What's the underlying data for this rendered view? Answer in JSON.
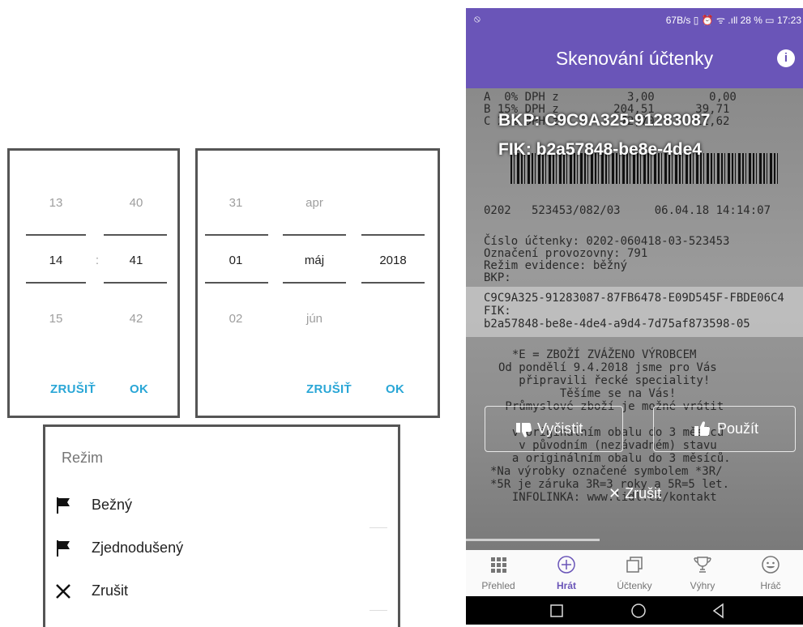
{
  "time_picker": {
    "hours": [
      "13",
      "14",
      "15"
    ],
    "minutes": [
      "40",
      "41",
      "42"
    ],
    "separator": ":",
    "cancel_label": "ZRUŠIŤ",
    "ok_label": "OK"
  },
  "date_picker": {
    "days": [
      "31",
      "01",
      "02"
    ],
    "months": [
      "apr",
      "máj",
      "jún"
    ],
    "year": "2018",
    "cancel_label": "ZRUŠIŤ",
    "ok_label": "OK"
  },
  "mode_dialog": {
    "title": "Režim",
    "options": [
      {
        "label": "Bežný",
        "icon": "flag-icon"
      },
      {
        "label": "Zjednodušený",
        "icon": "flag-icon"
      },
      {
        "label": "Zrušit",
        "icon": "close-icon"
      }
    ]
  },
  "phone": {
    "status": {
      "left_icon": "location-off-icon",
      "right": "67B/s ▯ ⏰ ᯤ .ıll 28 % ▭ 17:23"
    },
    "title": "Skenování účtenky",
    "info_icon": "info-icon",
    "overlay": {
      "bkp": "BKP: C9C9A325-91283087",
      "fik": "FIK: b2a57848-be8e-4de4"
    },
    "receipt_lines": [
      "A  0% DPH z          3,00        0,00",
      "B 15% DPH z        204,51      39,71",
      "C 21% DPH z         72,70      12,62",
      "0202   523453/082/03     06.04.18 14:14:07",
      "Číslo účtenky: 0202-060418-03-523453",
      "Označení provozovny: 791",
      "Režim evidence: běžný",
      "BKP:",
      "C9C9A325-91283087-87FB6478-E09D545F-FBDE06C4",
      "FIK:",
      "b2a57848-be8e-4de4-a9d4-7d75af873598-05",
      "  *E = ZBOŽÍ ZVÁŽENO VÝROBCEM",
      "Od pondělí 9.4.2018 jsme pro Vás",
      "   připravili řecké speciality!",
      "         Těšíme se na Vás!",
      " Průmyslové zboží je možné vrátit",
      "  v originálním obalu do 3 měsíců",
      "   v původním (nezávadném) stavu",
      "  a originálním obalu do 3 měsíců.",
      "*Na výrobky označené symbolem *3R/",
      "*5R je záruka 3R=3 roky a 5R=5 let.",
      "  INFOLINKA: www.lidl.cz/kontakt"
    ],
    "actions": {
      "clear_label": "Vyčistit",
      "use_label": "Použít",
      "cancel_label": "✕ Zrušit"
    },
    "nav": [
      {
        "label": "Přehled",
        "icon": "grid-icon",
        "active": false
      },
      {
        "label": "Hrát",
        "icon": "plus-circle-icon",
        "active": true
      },
      {
        "label": "Účtenky",
        "icon": "receipts-icon",
        "active": false
      },
      {
        "label": "Výhry",
        "icon": "trophy-icon",
        "active": false
      },
      {
        "label": "Hráč",
        "icon": "smiley-icon",
        "active": false
      }
    ],
    "colors": {
      "primary": "#6a55b8",
      "accent": "#29a6d6"
    }
  }
}
